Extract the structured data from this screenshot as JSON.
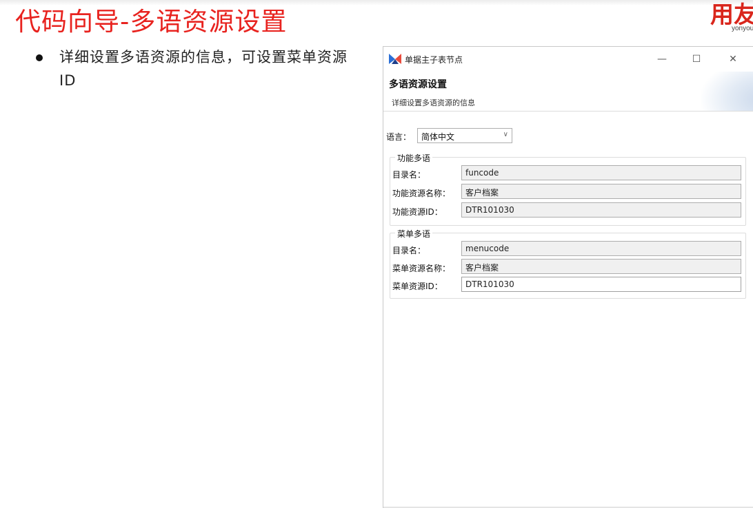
{
  "slide": {
    "title": "代码向导-多语资源设置",
    "bullet": "详细设置多语资源的信息，可设置菜单资源ID",
    "logo_cn": "用友",
    "logo_en": "yonyou"
  },
  "dialog": {
    "window_title": "单据主子表节点",
    "minimize_glyph": "—",
    "maximize_glyph": "☐",
    "close_glyph": "✕",
    "section_title": "多语资源设置",
    "section_desc": "详细设置多语资源的信息",
    "language": {
      "label": "语言：",
      "selected": "简体中文"
    },
    "function_group": {
      "title": "功能多语",
      "dir_label": "目录名：",
      "dir_value": "funcode",
      "name_label": "功能资源名称：",
      "name_value": "客户档案",
      "id_label": "功能资源ID：",
      "id_value": "DTR101030"
    },
    "menu_group": {
      "title": "菜单多语",
      "dir_label": "目录名：",
      "dir_value": "menucode",
      "name_label": "菜单资源名称：",
      "name_value": "客户档案",
      "id_label": "菜单资源ID：",
      "id_value": "DTR101030"
    }
  },
  "colors": {
    "title_red": "#e8231f",
    "logo_red": "#d9261c",
    "field_readonly": "#f0f0f0"
  }
}
